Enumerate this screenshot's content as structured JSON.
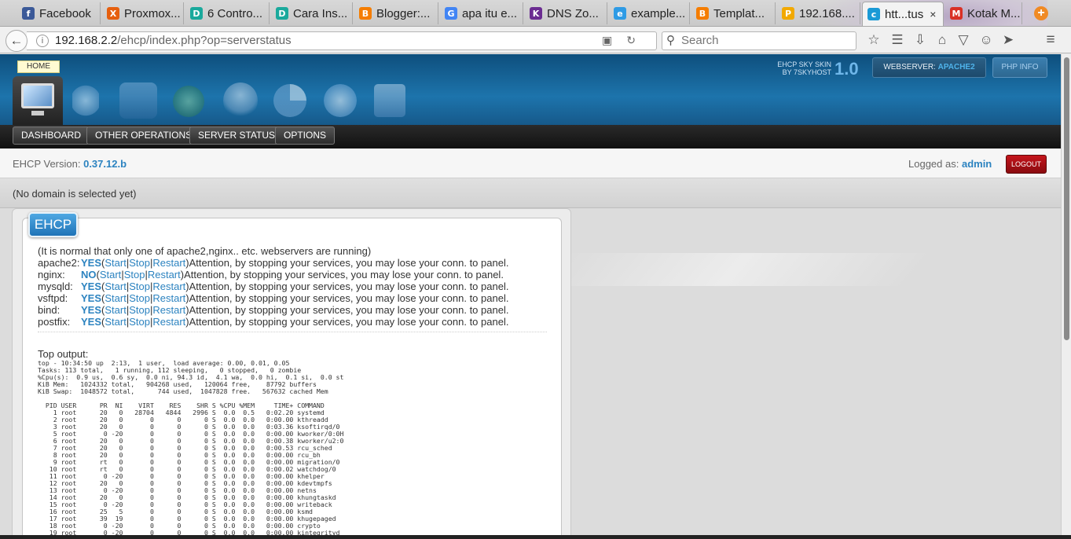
{
  "browser": {
    "tabs": [
      {
        "label": "Facebook",
        "icon": "facebook-icon",
        "color": "#3b5998",
        "glyph": "f"
      },
      {
        "label": "Proxmox...",
        "icon": "proxmox-icon",
        "color": "#e65f0e",
        "glyph": "X"
      },
      {
        "label": "6 Contro...",
        "icon": "docs-icon",
        "color": "#1aa99c",
        "glyph": "D"
      },
      {
        "label": "Cara Ins...",
        "icon": "docs-icon",
        "color": "#1aa99c",
        "glyph": "D"
      },
      {
        "label": "Blogger:...",
        "icon": "blogger-icon",
        "color": "#f57d00",
        "glyph": "B"
      },
      {
        "label": "apa itu e...",
        "icon": "google-icon",
        "color": "#4285f4",
        "glyph": "G"
      },
      {
        "label": "DNS Zo...",
        "icon": "dns-icon",
        "color": "#6b2c91",
        "glyph": "K"
      },
      {
        "label": "example...",
        "icon": "example-icon",
        "color": "#2e9be5",
        "glyph": "e"
      },
      {
        "label": "Templat...",
        "icon": "blogger-icon",
        "color": "#f57d00",
        "glyph": "B"
      },
      {
        "label": "192.168....",
        "icon": "phpmyadmin-icon",
        "color": "#f2a900",
        "glyph": "P"
      },
      {
        "label": "htt...tus",
        "icon": "site-icon",
        "color": "#1a9ad6",
        "glyph": "c",
        "close": "×"
      },
      {
        "label": "Kotak M...",
        "icon": "gmail-icon",
        "color": "#d93025",
        "glyph": "M"
      }
    ],
    "new_tab": "+",
    "url_host": "192.168.2.2",
    "url_path": "/ehcp/index.php?op=serverstatus",
    "search_placeholder": "Search"
  },
  "header": {
    "home_label": "HOME",
    "skin_line1": "EHCP SKY SKIN",
    "skin_line2": "BY 7SKYHOST",
    "skin_version": "1.0",
    "webserver_label": "WEBSERVER:",
    "webserver_value": "APACHE2",
    "php_info": "PHP INFO",
    "icons": [
      "document-icon",
      "mysql-database-icon",
      "ftp-icon",
      "user-icon",
      "pie-chart-icon",
      "info-icon",
      "save-icon"
    ]
  },
  "menu": {
    "items": [
      "DASHBOARD",
      "OTHER OPERATIONS",
      "SERVER STATUS",
      "OPTIONS"
    ]
  },
  "version": {
    "label": "EHCP Version:",
    "value": "0.37.12.b",
    "logged_label": "Logged as:",
    "user": "admin",
    "logout": "LOGOUT"
  },
  "domain_status": "(No domain is selected yet)",
  "panel": {
    "tag": "EHCP",
    "note": "(It is normal that only one of apache2,nginx.. etc. webservers are running)",
    "action_start": "Start",
    "action_stop": "Stop",
    "action_restart": "Restart",
    "warning": "Attention, by stopping your services, you may lose your conn. to panel.",
    "services": [
      {
        "name": "apache2:",
        "status": "YES"
      },
      {
        "name": "nginx:",
        "status": "NO "
      },
      {
        "name": "mysqld:",
        "status": "YES"
      },
      {
        "name": "vsftpd:",
        "status": "YES"
      },
      {
        "name": "bind:",
        "status": "YES"
      },
      {
        "name": "postfix:",
        "status": "YES"
      }
    ],
    "top_title": "Top output:",
    "top_text": "top - 10:34:50 up  2:13,  1 user,  load average: 0.00, 0.01, 0.05\nTasks: 113 total,   1 running, 112 sleeping,   0 stopped,   0 zombie\n%Cpu(s):  0.9 us,  0.6 sy,  0.0 ni, 94.3 id,  4.1 wa,  0.0 hi,  0.1 si,  0.0 st\nKiB Mem:   1024332 total,   904268 used,   120064 free,    87792 buffers\nKiB Swap:  1048572 total,      744 used,  1047828 free.   567632 cached Mem\n\n  PID USER      PR  NI    VIRT    RES    SHR S %CPU %MEM     TIME+ COMMAND\n    1 root      20   0   28704   4844   2996 S  0.0  0.5   0:02.20 systemd\n    2 root      20   0       0      0      0 S  0.0  0.0   0:00.00 kthreadd\n    3 root      20   0       0      0      0 S  0.0  0.0   0:03.36 ksoftirqd/0\n    5 root       0 -20       0      0      0 S  0.0  0.0   0:00.00 kworker/0:0H\n    6 root      20   0       0      0      0 S  0.0  0.0   0:00.38 kworker/u2:0\n    7 root      20   0       0      0      0 S  0.0  0.0   0:00.53 rcu_sched\n    8 root      20   0       0      0      0 S  0.0  0.0   0:00.00 rcu_bh\n    9 root      rt   0       0      0      0 S  0.0  0.0   0:00.00 migration/0\n   10 root      rt   0       0      0      0 S  0.0  0.0   0:00.02 watchdog/0\n   11 root       0 -20       0      0      0 S  0.0  0.0   0:00.00 khelper\n   12 root      20   0       0      0      0 S  0.0  0.0   0:00.00 kdevtmpfs\n   13 root       0 -20       0      0      0 S  0.0  0.0   0:00.00 netns\n   14 root      20   0       0      0      0 S  0.0  0.0   0:00.00 khungtaskd\n   15 root       0 -20       0      0      0 S  0.0  0.0   0:00.00 writeback\n   16 root      25   5       0      0      0 S  0.0  0.0   0:00.00 ksmd\n   17 root      39  19       0      0      0 S  0.0  0.0   0:00.00 khugepaged\n   18 root       0 -20       0      0      0 S  0.0  0.0   0:00.00 crypto\n   19 root       0 -20       0      0      0 S  0.0  0.0   0:00.00 kintegrityd"
  }
}
